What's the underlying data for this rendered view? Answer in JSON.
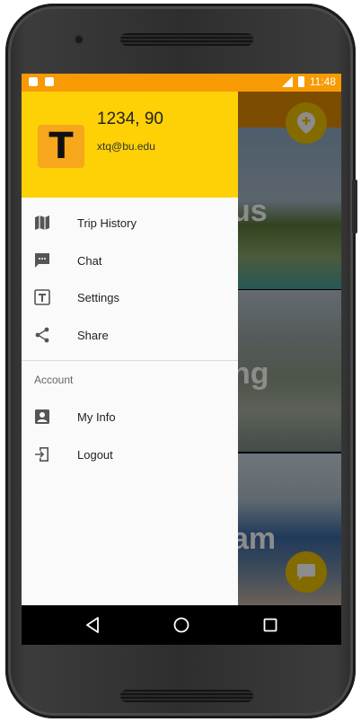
{
  "status_bar": {
    "time": "11:48"
  },
  "drawer": {
    "header": {
      "name": "1234, 90",
      "email": "xtq@bu.edu",
      "avatar_letter": "T"
    },
    "items": [
      {
        "label": "Trip History",
        "icon": "map-icon"
      },
      {
        "label": "Chat",
        "icon": "chat-icon"
      },
      {
        "label": "Settings",
        "icon": "settings-t-icon"
      },
      {
        "label": "Share",
        "icon": "share-icon"
      }
    ],
    "section_label": "Account",
    "account_items": [
      {
        "label": "My Info",
        "icon": "person-icon"
      },
      {
        "label": "Logout",
        "icon": "logout-icon"
      }
    ]
  },
  "background_cards": [
    {
      "city_fragment": "us"
    },
    {
      "city_fragment": "ng"
    },
    {
      "city_fragment": "am"
    }
  ],
  "colors": {
    "status_bar": "#f79a04",
    "drawer_header": "#fdd106",
    "avatar_bg": "#f7a71c",
    "fab": "#f0c400"
  }
}
